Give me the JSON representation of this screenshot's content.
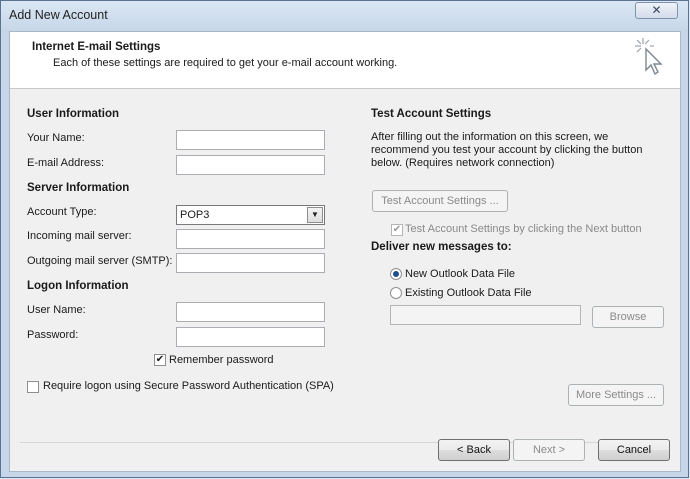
{
  "window": {
    "title": "Add New Account",
    "close_glyph": "✕"
  },
  "header": {
    "title": "Internet E-mail Settings",
    "subtitle": "Each of these settings are required to get your e-mail account working.",
    "icon": "cursor-sparkle-icon"
  },
  "user_info": {
    "heading": "User Information",
    "your_name_label": "Your Name:",
    "your_name_value": "",
    "email_label": "E-mail Address:",
    "email_value": ""
  },
  "server_info": {
    "heading": "Server Information",
    "account_type_label": "Account Type:",
    "account_type_value": "POP3",
    "incoming_label": "Incoming mail server:",
    "incoming_value": "",
    "outgoing_label": "Outgoing mail server (SMTP):",
    "outgoing_value": ""
  },
  "logon_info": {
    "heading": "Logon Information",
    "username_label": "User Name:",
    "username_value": "",
    "password_label": "Password:",
    "password_value": "",
    "remember_label": "Remember password",
    "remember_checked": true,
    "spa_label": "Require logon using Secure Password Authentication (SPA)",
    "spa_checked": false
  },
  "test_settings": {
    "heading": "Test Account Settings",
    "description": "After filling out the information on this screen, we recommend you test your account by clicking the button below. (Requires network connection)",
    "test_button": "Test Account Settings ...",
    "test_next_label": "Test Account Settings by clicking the Next button",
    "test_next_checked": true
  },
  "deliver": {
    "heading": "Deliver new messages to:",
    "new_file_label": "New Outlook Data File",
    "existing_file_label": "Existing Outlook Data File",
    "selected": "new",
    "browse_button": "Browse"
  },
  "more_settings_button": "More Settings ...",
  "footer": {
    "back_button": "< Back",
    "next_button": "Next >",
    "cancel_button": "Cancel"
  }
}
